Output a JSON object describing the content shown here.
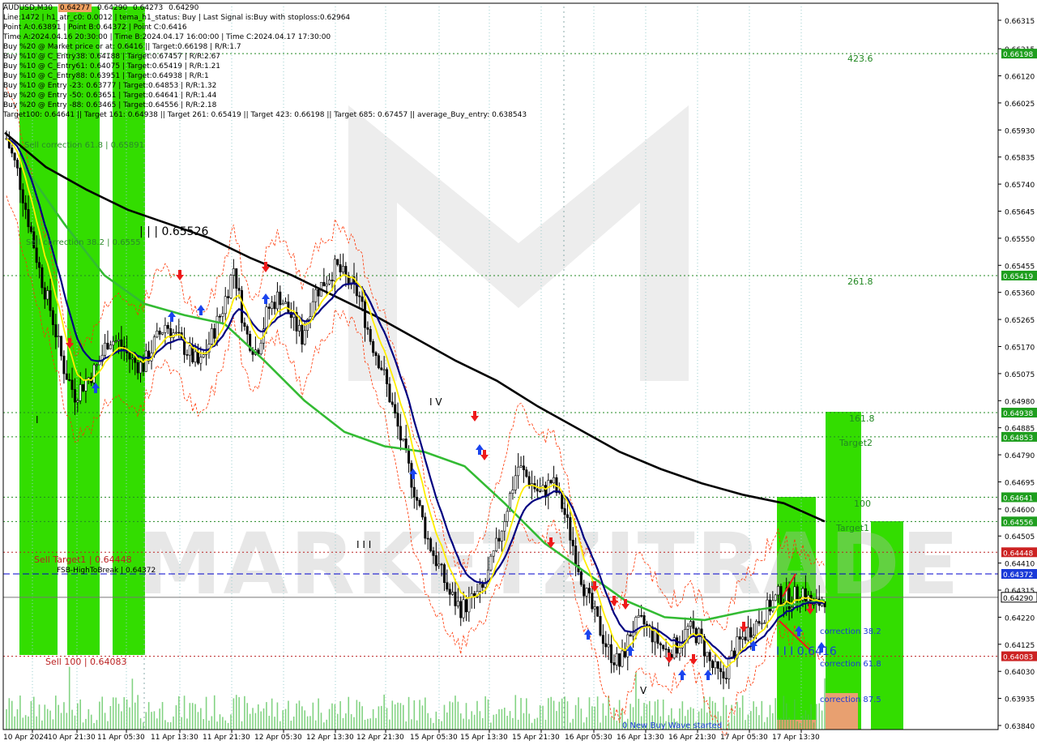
{
  "symbol": {
    "name": "AUDUSD,M30",
    "ohlc": [
      "0.64277",
      "0.64290",
      "0.64273",
      "0.64290"
    ]
  },
  "info_lines": [
    "Line:1472 | h1_atr_c0: 0.0012 | tema_h1_status: Buy | Last Signal is:Buy with stoploss:0.62964",
    "Point A:0.63891 | Point B:0.64372 | Point C:0.6416",
    "Time A:2024.04.16 20:30:00 | Time B:2024.04.17 16:00:00 | Time C:2024.04.17 17:30:00",
    "Buy %20 @ Market price or at: 0.6416 || Target:0.66198 | R/R:1.7",
    "Buy %10 @ C_Entry38: 0.64188 | Target:0.67457 | R/R:2.67",
    "Buy %10 @ C_Entry61: 0.64075 | Target:0.65419 | R/R:1.21",
    "Buy %10 @ C_Entry88: 0.63951 | Target:0.64938 | R/R:1",
    "Buy %10 @ Entry -23: 0.63777 | Target:0.64853 | R/R:1.32",
    "Buy %20 @ Entry -50: 0.63651 | Target:0.64641 | R/R:1.44",
    "Buy %20 @ Entry -88: 0.63465 | Target:0.64556 | R/R:2.18",
    "Target100: 0.64641 || Target 161: 0.64938 || Target 261: 0.65419 || Target 423: 0.66198 || Target 685: 0.67457 || average_Buy_entry: 0.638543"
  ],
  "price_axis": {
    "ticks": [
      "0.66315",
      "0.66215",
      "0.66120",
      "0.66025",
      "0.65930",
      "0.65835",
      "0.65740",
      "0.65645",
      "0.65550",
      "0.65455",
      "0.65360",
      "0.65265",
      "0.65170",
      "0.65075",
      "0.64980",
      "0.64885",
      "0.64790",
      "0.64695",
      "0.64600",
      "0.64505",
      "0.64410",
      "0.64315",
      "0.64220",
      "0.64125",
      "0.64030",
      "0.63935",
      "0.63840"
    ],
    "badges": [
      {
        "label": "0.66198",
        "kind": "green"
      },
      {
        "label": "0.65419",
        "kind": "green"
      },
      {
        "label": "0.64938",
        "kind": "green"
      },
      {
        "label": "0.64853",
        "kind": "green"
      },
      {
        "label": "0.64641",
        "kind": "green"
      },
      {
        "label": "0.64556",
        "kind": "green"
      },
      {
        "label": "0.64448",
        "kind": "red"
      },
      {
        "label": "0.64372",
        "kind": "blue"
      },
      {
        "label": "0.64290",
        "kind": "current"
      },
      {
        "label": "0.64083",
        "kind": "red"
      }
    ]
  },
  "time_axis": [
    "10 Apr 2024",
    "10 Apr 21:30",
    "11 Apr 05:30",
    "11 Apr 13:30",
    "11 Apr 21:30",
    "12 Apr 05:30",
    "12 Apr 13:30",
    "12 Apr 21:30",
    "15 Apr 05:30",
    "15 Apr 13:30",
    "15 Apr 21:30",
    "16 Apr 05:30",
    "16 Apr 13:30",
    "16 Apr 21:30",
    "17 Apr 05:30",
    "17 Apr 13:30"
  ],
  "annotations": {
    "sell_corr_618": "Sell correction 61.8 | 0.65891",
    "sell_corr_382": "Sell correction 38.2 | 0.6555",
    "wave3_top": "| | | 0.65526",
    "wave1": "I",
    "wave3_low": "I I I",
    "wave4": "I V",
    "wave5": "V",
    "wave3_c": "I I I 0.6416",
    "new_wave": "0 New Buy Wave started",
    "sell_target1": "Sell Target1 | 0.64448",
    "fsb": "FSB-HighToBreak | 0.64372",
    "sell100": "Sell 100 | 0.64083",
    "t423": "423.6",
    "t261": "261.8",
    "t161": "161.8",
    "target2": "Target2",
    "t100": "100",
    "target1": "Target1",
    "corr382": "correction 38.2",
    "corr618": "correction 61.8",
    "corr875": "correction 87.5",
    "watermark": "MARKETZITRADE"
  },
  "colors": {
    "green_band": "#33dd00",
    "level_green": "#228822",
    "level_red": "#bb2222",
    "level_blue": "#0000cc",
    "ema_green": "#33bb33",
    "ema_black": "#000000",
    "ema_navy": "#000080",
    "ema_yellow": "#ffee00",
    "envelope": "#ff3300"
  },
  "chart_data": {
    "type": "candlestick",
    "symbol": "AUDUSD",
    "timeframe": "M30",
    "ylim": [
      0.6384,
      0.66315
    ],
    "levels": [
      {
        "name": "423.6",
        "value": 0.66198
      },
      {
        "name": "261.8",
        "value": 0.65419
      },
      {
        "name": "161.8",
        "value": 0.64938
      },
      {
        "name": "Target2",
        "value": 0.64853
      },
      {
        "name": "100",
        "value": 0.64641
      },
      {
        "name": "Target1",
        "value": 0.64556
      },
      {
        "name": "Sell Target1",
        "value": 0.64448
      },
      {
        "name": "FSB-HighToBreak",
        "value": 0.64372
      },
      {
        "name": "current",
        "value": 0.6429
      },
      {
        "name": "Sell 100",
        "value": 0.64083
      }
    ],
    "close_path": [
      0.659,
      0.6578,
      0.656,
      0.6542,
      0.6528,
      0.651,
      0.65,
      0.6505,
      0.651,
      0.652,
      0.6518,
      0.6512,
      0.651,
      0.6518,
      0.6525,
      0.652,
      0.6515,
      0.651,
      0.652,
      0.653,
      0.6545,
      0.6522,
      0.6515,
      0.653,
      0.6535,
      0.6528,
      0.652,
      0.6535,
      0.654,
      0.6545,
      0.654,
      0.6535,
      0.652,
      0.651,
      0.6495,
      0.648,
      0.6465,
      0.645,
      0.644,
      0.643,
      0.6425,
      0.6428,
      0.6432,
      0.6445,
      0.646,
      0.6475,
      0.647,
      0.6465,
      0.647,
      0.646,
      0.6445,
      0.643,
      0.642,
      0.641,
      0.6405,
      0.6418,
      0.642,
      0.6415,
      0.641,
      0.6412,
      0.6418,
      0.6415,
      0.6405,
      0.64,
      0.641,
      0.6416,
      0.642,
      0.6425,
      0.643,
      0.6428,
      0.6432,
      0.6425,
      0.6429
    ],
    "ema_black": [
      0.6592,
      0.658,
      0.6572,
      0.6565,
      0.656,
      0.6555,
      0.6548,
      0.6542,
      0.6535,
      0.6528,
      0.652,
      0.6512,
      0.6505,
      0.6496,
      0.6488,
      0.648,
      0.6474,
      0.6469,
      0.6465,
      0.6462,
      0.64556
    ],
    "ema_green": [
      0.658,
      0.656,
      0.6542,
      0.6532,
      0.6528,
      0.6525,
      0.6512,
      0.6498,
      0.6487,
      0.6482,
      0.648,
      0.6475,
      0.6462,
      0.6448,
      0.6438,
      0.6428,
      0.6422,
      0.6421,
      0.6424,
      0.6426,
      0.6428
    ]
  }
}
